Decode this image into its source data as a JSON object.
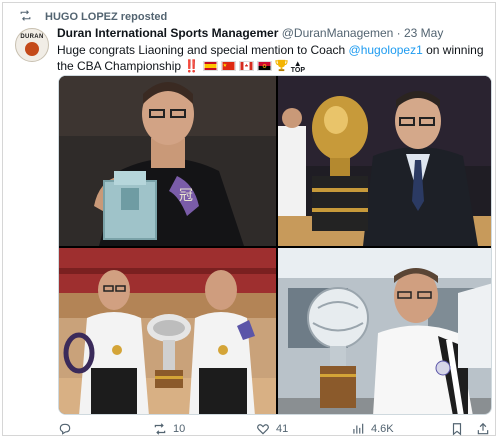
{
  "repost": {
    "icon": "repost-icon",
    "text": "HUGO LOPEZ reposted"
  },
  "author": {
    "avatar_text": "DURAN",
    "name": "Duran International Sports Managemer",
    "handle": "@DuranManagemen",
    "separator": "·",
    "date": "23 May"
  },
  "tweet": {
    "text_before": "Huge congrats Liaoning and special mention to Coach ",
    "mention": "@hugolopez1",
    "text_after": " on winning the CBA Championship",
    "bangs": "‼️",
    "emoji_icons": [
      "spain-flag-icon",
      "china-flag-icon",
      "canada-flag-icon",
      "angola-flag-icon",
      "trophy-icon",
      "top-arrow-icon"
    ],
    "top_label": "TOP"
  },
  "media": {
    "photos": [
      "coach-with-trophy-photo",
      "coach-with-cup-photo",
      "two-coaches-trophies-photo",
      "coach-holding-trophy-photo"
    ]
  },
  "actions": {
    "reply_count": "",
    "repost_count": "10",
    "like_count": "41",
    "views_count": "4.6K"
  },
  "colors": {
    "accent": "#1d9bf0",
    "secondary_text": "#536471",
    "border": "#cfd9de"
  }
}
